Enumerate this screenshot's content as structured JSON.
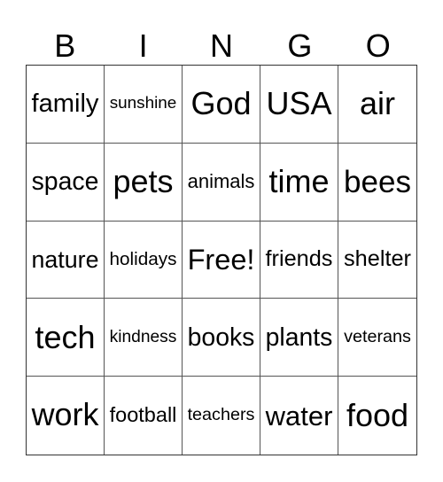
{
  "card": {
    "header_letters": [
      "B",
      "I",
      "N",
      "G",
      "O"
    ],
    "rows": [
      [
        "family",
        "sunshine",
        "God",
        "USA",
        "air"
      ],
      [
        "space",
        "pets",
        "animals",
        "time",
        "bees"
      ],
      [
        "nature",
        "holidays",
        "Free!",
        "friends",
        "shelter"
      ],
      [
        "tech",
        "kindness",
        "books",
        "plants",
        "veterans"
      ],
      [
        "work",
        "football",
        "teachers",
        "water",
        "food"
      ]
    ]
  }
}
